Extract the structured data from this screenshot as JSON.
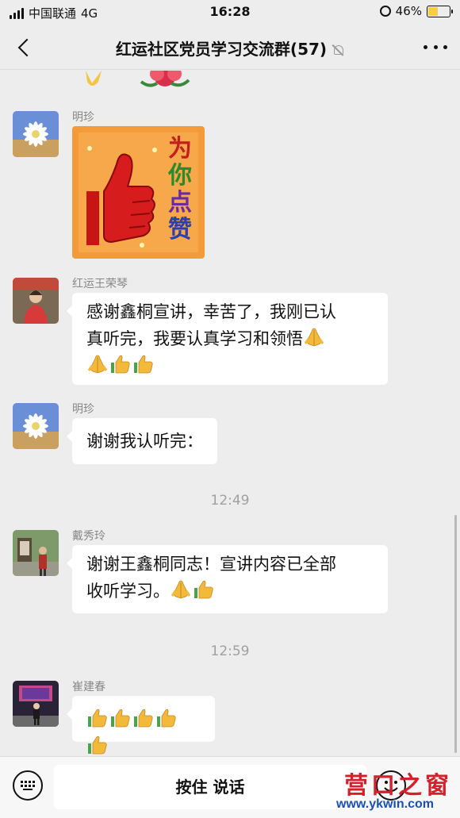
{
  "status_bar": {
    "carrier": "中国联通",
    "network": "4G",
    "time": "16:28",
    "battery": "46%",
    "battery_level": 0.46
  },
  "header": {
    "title": "红运社区党员学习交流群(57)"
  },
  "sticker_text": [
    "为",
    "你",
    "点",
    "赞"
  ],
  "messages": [
    {
      "sender": "明珍"
    },
    {
      "sender": "红运王荣琴",
      "line1": "感谢鑫桐宣讲，幸苦了，我刚已认",
      "line2": "真听完，我要认真学习和领悟"
    },
    {
      "sender": "明珍",
      "line1": "谢谢我认听完："
    },
    {
      "sender": "戴秀玲",
      "line1": "谢谢王鑫桐同志！宣讲内容已全部",
      "line2": "收听学习。"
    },
    {
      "sender": "崔建春"
    }
  ],
  "time_dividers": [
    "12:49",
    "12:59"
  ],
  "input": {
    "hold_to_talk": "按住 说话"
  },
  "watermark": {
    "title": "营口之窗",
    "url": "www.ykwin.com"
  },
  "colors": {
    "background": "#ededed",
    "bubble": "#ffffff",
    "battery_fill": "#f7cf3d"
  },
  "icons": [
    "signal-icon",
    "battery-icon",
    "back-icon",
    "mute-icon",
    "more-icon",
    "keyboard-icon",
    "emoji-icon",
    "pray-emoji",
    "thumbs-up-emoji"
  ]
}
